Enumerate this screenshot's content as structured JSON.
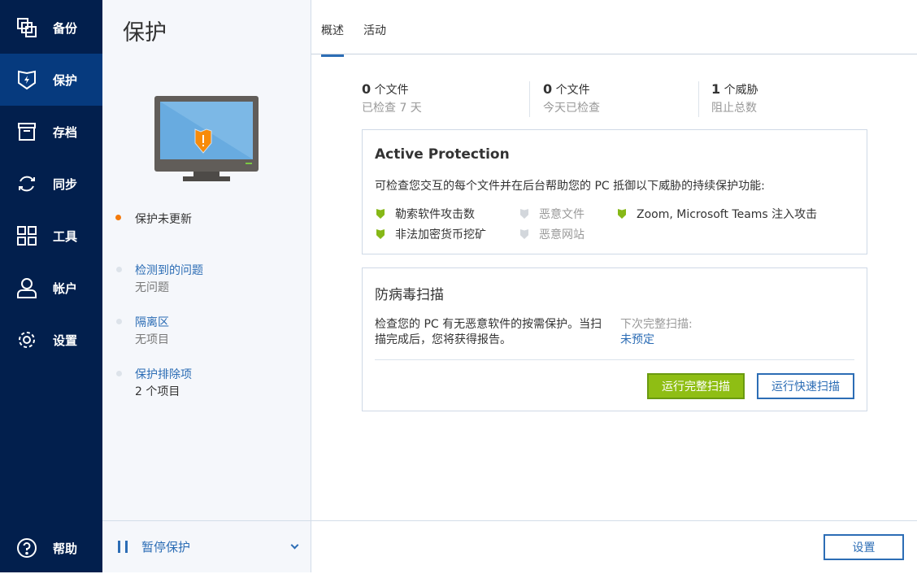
{
  "sidebar": {
    "items": [
      {
        "label": "备份",
        "icon": "backup-icon"
      },
      {
        "label": "保护",
        "icon": "shield-bolt-icon",
        "active": true
      },
      {
        "label": "存档",
        "icon": "archive-icon"
      },
      {
        "label": "同步",
        "icon": "sync-icon"
      },
      {
        "label": "工具",
        "icon": "tools-grid-icon"
      },
      {
        "label": "帐户",
        "icon": "account-icon"
      },
      {
        "label": "设置",
        "icon": "gear-icon"
      }
    ],
    "help": "帮助"
  },
  "panel": {
    "title": "保护",
    "status": "保护未更新",
    "status_color": "#f47a0c",
    "items": [
      {
        "label": "检测到的问题",
        "value": "无问题"
      },
      {
        "label": "隔离区",
        "value": "无项目"
      },
      {
        "label": "保护排除项",
        "value": "2 个项目"
      }
    ],
    "pause": "暂停保护"
  },
  "tabs": [
    "概述",
    "活动"
  ],
  "stats": [
    {
      "num": "0",
      "unit": "个文件",
      "label": "已检查 7 天"
    },
    {
      "num": "0",
      "unit": "个文件",
      "label": "今天已检查"
    },
    {
      "num": "1",
      "unit": "个威胁",
      "label": "阻止总数"
    }
  ],
  "active_protection": {
    "title": "Active Protection",
    "desc": "可检查您交互的每个文件并在后台帮助您的 PC 抵御以下威胁的持续保护功能:",
    "features": [
      {
        "label": "勒索软件攻击数",
        "enabled": true
      },
      {
        "label": "非法加密货币挖矿",
        "enabled": true
      },
      {
        "label": "恶意文件",
        "enabled": false
      },
      {
        "label": "恶意网站",
        "enabled": false
      },
      {
        "label": "Zoom, Microsoft Teams 注入攻击",
        "enabled": true
      }
    ]
  },
  "scan": {
    "title": "防病毒扫描",
    "desc1": "检查您的 PC 有无恶意软件的按需保护。当扫",
    "desc2": "描完成后，您将获得报告。",
    "next_label": "下次完整扫描:",
    "next_value": "未预定",
    "full": "运行完整扫描",
    "quick": "运行快速扫描"
  },
  "footer": {
    "settings": "设置"
  },
  "colors": {
    "sidebar": "#021f4d",
    "active": "#063a7e",
    "accent": "#2c6db5",
    "green": "#86b817"
  }
}
